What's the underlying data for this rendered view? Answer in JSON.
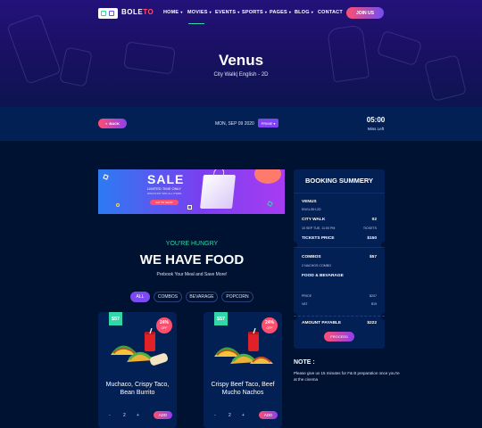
{
  "brand": {
    "logo_main": "BOLE",
    "logo_accent": "TO"
  },
  "nav": {
    "items": [
      {
        "label": "HOME",
        "caret": true
      },
      {
        "label": "MOVIES",
        "caret": true
      },
      {
        "label": "EVENTS",
        "caret": true
      },
      {
        "label": "SPORTS",
        "caret": true
      },
      {
        "label": "PAGES",
        "caret": true
      },
      {
        "label": "BLOG",
        "caret": true
      },
      {
        "label": "CONTACT",
        "caret": false
      }
    ],
    "join_label": "JOIN US"
  },
  "movie": {
    "title": "Venus",
    "subtitle": "City Walk| English - 2D"
  },
  "timer_bar": {
    "back_label": "BACK",
    "date": "MON, SEP 09 2020",
    "select_value": "PRIME",
    "time_left": "05:00",
    "time_left_label": "Mins Left"
  },
  "banner": {
    "sale_word": "SALE",
    "line1": "LIMITED TIME ONLY",
    "line2": "DISCOUNT 30% ALL ITEMS",
    "button": "GO TO SHOP"
  },
  "food": {
    "kicker": "YOU'RE HUNGRY",
    "title": "WE HAVE FOOD",
    "subtitle": "Prebook Your Meal and Save More!",
    "tabs": [
      "ALL",
      "COMBOS",
      "BEVARAGE",
      "POPCORN"
    ],
    "active_tab": "ALL",
    "items": [
      {
        "price": "$57",
        "discount": "24%",
        "discount_suffix": "OFF",
        "name": "Muchaco, Crispy Taco, Bean Burrito",
        "qty": "2",
        "add_label": "ADD"
      },
      {
        "price": "$57",
        "discount": "24%",
        "discount_suffix": "OFF",
        "name": "Crispy Beef Taco, Beef Mucho Nachos",
        "qty": "2",
        "add_label": "ADD"
      }
    ]
  },
  "summary": {
    "title": "BOOKING SUMMERY",
    "movie_name": "VENUS",
    "movie_format": "ENGLISH-2D",
    "venue": "CITY WALK",
    "venue_screen": "02",
    "showtime": "10 SEP TUE, 11:00 PM",
    "tickets_word": "TICKETS",
    "tickets_price_label": "TICKETS PRICE",
    "tickets_price": "$150",
    "combos_label": "COMBOS",
    "combos_price": "$57",
    "combos_detail": "2 NACHOS COMBO",
    "food_label": "FOOD & BEVARAGE",
    "price_label": "PRICE",
    "price_value": "$207",
    "vat_label": "VAT",
    "vat_value": "$15",
    "payable_label": "AMOUNT PAYABLE",
    "payable_value": "$222",
    "proceed_label": "PROCEED"
  },
  "note": {
    "title": "NOTE :",
    "text": "Please give us 15 minutes for F& B preparation once you're at the cinema"
  },
  "colors": {
    "accent_green": "#31d7a9",
    "accent_pink": "#ff4f6f",
    "accent_purple": "#7b4af3",
    "bg": "#001232"
  }
}
